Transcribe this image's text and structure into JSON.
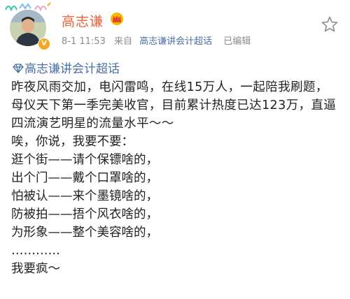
{
  "author": {
    "name": "高志谦",
    "verified": true,
    "verified_badge": "V",
    "avatar": "avatar-photo"
  },
  "meta": {
    "time": "8-1 11:53",
    "from_label": "来自",
    "source": "高志谦讲会计超话",
    "edited": "已编辑"
  },
  "topic": {
    "label": "高志谦讲会计超话",
    "icon": "super-topic-diamond-icon"
  },
  "content": {
    "paragraph1": "昨夜风雨交加，电闪雷鸣，在线15万人，一起陪我刷题，母仪天下第一季完美收官，目前累计热度已达123万，直逼四流演艺明星的流量水平～～",
    "lines": [
      "唉，你说，我要不要：",
      "逛个街——请个保镖啥的，",
      "出个门——戴个口罩啥的，",
      "怕被认——来个墨镜啥的，",
      "防被拍——捂个风衣啥的，",
      "为形象——整个美容啥的，",
      "…………",
      "我要疯～"
    ]
  },
  "colors": {
    "username": "#e8623a",
    "link": "#4a6fa5",
    "meta": "#8c8c8c",
    "text": "#222222",
    "verified": "#f5a623"
  }
}
